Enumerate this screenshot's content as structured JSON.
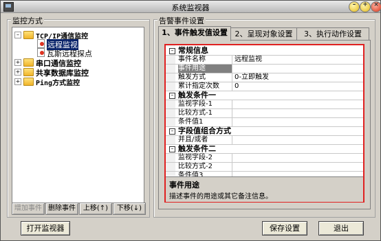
{
  "window": {
    "title": "系统监视器"
  },
  "left_panel": {
    "group_label": "监控方式",
    "tree": [
      {
        "label": "TCP/IP通信监控",
        "expanded": "-"
      },
      {
        "label": "远程监视",
        "selected": true
      },
      {
        "label": "瓦斯远程探点"
      },
      {
        "label": "串口通信监控",
        "expanded": "+"
      },
      {
        "label": "共享数据库监控",
        "expanded": "+"
      },
      {
        "label": "Ping方式监控",
        "expanded": "+"
      }
    ],
    "buttons": {
      "add": "增加事件",
      "delete": "删除事件",
      "up": "上移(↑)",
      "down": "下移(↓)"
    }
  },
  "right_panel": {
    "group_label": "告警事件设置",
    "tabs": [
      "1、事件触发值设置",
      "2、呈现对象设置",
      "3、执行动作设置"
    ],
    "properties": [
      {
        "type": "cat",
        "label": "常规信息"
      },
      {
        "type": "prop",
        "label": "事件名称",
        "value": "远程监视"
      },
      {
        "type": "prop",
        "label": "事件用途",
        "value": "",
        "selected": true
      },
      {
        "type": "prop",
        "label": "触发方式",
        "value": "0-立即触发"
      },
      {
        "type": "prop",
        "label": "累计指定次数",
        "value": "0"
      },
      {
        "type": "cat",
        "label": "触发条件一"
      },
      {
        "type": "prop",
        "label": "监视字段-1",
        "value": ""
      },
      {
        "type": "prop",
        "label": "比较方式-1",
        "value": ""
      },
      {
        "type": "prop",
        "label": "条件值1",
        "value": ""
      },
      {
        "type": "cat",
        "label": "字段值组合方式"
      },
      {
        "type": "prop",
        "label": "并且/或者",
        "value": ""
      },
      {
        "type": "cat",
        "label": "触发条件二"
      },
      {
        "type": "prop",
        "label": "监视字段-2",
        "value": ""
      },
      {
        "type": "prop",
        "label": "比较方式-2",
        "value": ""
      },
      {
        "type": "prop",
        "label": "条件值3",
        "value": ""
      }
    ],
    "help": {
      "title": "事件用途",
      "description": "描述事件的用途或其它备注信息。"
    }
  },
  "bottom_buttons": {
    "open_monitor": "打开监视器",
    "save": "保存设置",
    "exit": "退出"
  },
  "colors": {
    "highlight_frame": "#e02020",
    "selection": "#0a246a"
  }
}
